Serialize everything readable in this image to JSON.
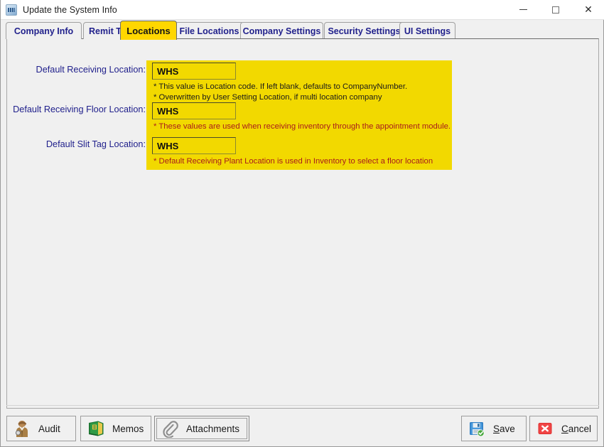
{
  "window": {
    "title": "Update the System Info",
    "icon": "app-window-icon",
    "controls": {
      "minimize": "–",
      "maximize": "□",
      "close": "✕"
    }
  },
  "tabs": [
    {
      "label": "Company Info",
      "active": false
    },
    {
      "label": "Remit T",
      "active": false,
      "clipped": true
    },
    {
      "label": "Locations",
      "active": true
    },
    {
      "label": "File Locations",
      "active": false
    },
    {
      "label": "Company Settings",
      "active": false
    },
    {
      "label": "Security Settings",
      "active": false
    },
    {
      "label": "UI Settings",
      "active": false
    }
  ],
  "form": {
    "fields": [
      {
        "label": "Default Receiving Location:",
        "value": "WHS",
        "hints": [
          {
            "text": "* This value is Location code. If left blank, defaults to CompanyNumber.",
            "color": "dark"
          },
          {
            "text": "* Overwritten by User Setting Location, if multi location company",
            "color": "dark"
          }
        ]
      },
      {
        "label": "Default Receiving Floor Location:",
        "value": "WHS",
        "hints": [
          {
            "text": "* These values are used when receiving inventory through the appointment module.",
            "color": "red"
          }
        ]
      },
      {
        "label": "Default Slit Tag Location:",
        "value": "WHS",
        "hints": [
          {
            "text": "* Default Receiving Plant Location is used in Inventory to select a floor location",
            "color": "red"
          }
        ]
      }
    ]
  },
  "footer": {
    "left_buttons": [
      {
        "label": "Audit",
        "icon": "auditor-person-icon",
        "focused": false
      },
      {
        "label": "Memos",
        "icon": "green-book-icon",
        "focused": false
      },
      {
        "label": "Attachments",
        "icon": "paperclip-icon",
        "focused": true
      }
    ],
    "right_buttons": [
      {
        "label": "Save",
        "accel": "S",
        "icon": "floppy-disk-save-icon",
        "focused": false
      },
      {
        "label": "Cancel",
        "accel": "C",
        "icon": "red-x-cancel-icon",
        "focused": false
      }
    ]
  },
  "colors": {
    "accent_yellow": "#f2d900",
    "tab_text": "#21218c",
    "hint_red": "#a81c1c",
    "window_bg": "#f0f0f0"
  }
}
